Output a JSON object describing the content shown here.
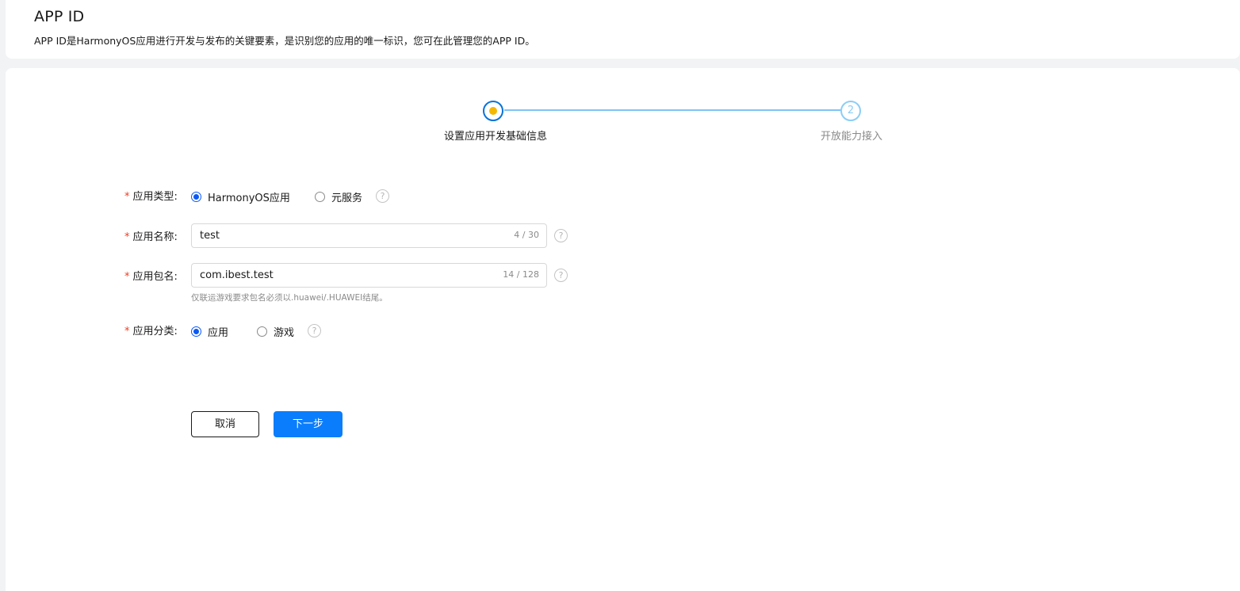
{
  "header": {
    "title": "APP ID",
    "description": "APP ID是HarmonyOS应用进行开发与发布的关键要素，是识别您的应用的唯一标识，您可在此管理您的APP ID。"
  },
  "stepper": {
    "steps": [
      {
        "index": "1",
        "label": "设置应用开发基础信息",
        "state": "active"
      },
      {
        "index": "2",
        "label": "开放能力接入",
        "state": "pending"
      }
    ],
    "active_dot_color": "#f5b800",
    "line_color": "#7cc4f5"
  },
  "form": {
    "required_mark": "*",
    "app_type": {
      "label": "应用类型:",
      "options": [
        "HarmonyOS应用",
        "元服务"
      ],
      "selected": "HarmonyOS应用"
    },
    "app_name": {
      "label": "应用名称:",
      "value": "test",
      "counter": "4 / 30"
    },
    "package_name": {
      "label": "应用包名:",
      "value": "com.ibest.test",
      "counter": "14 / 128",
      "hint": "仅联运游戏要求包名必须以.huawei/.HUAWEI结尾。"
    },
    "category": {
      "label": "应用分类:",
      "options": [
        "应用",
        "游戏"
      ],
      "selected": "应用"
    },
    "help_glyph": "?"
  },
  "buttons": {
    "cancel": "取消",
    "next": "下一步"
  },
  "colors": {
    "primary": "#0a7dfc",
    "radio_checked": "#0a59f7",
    "required": "#e84026"
  }
}
